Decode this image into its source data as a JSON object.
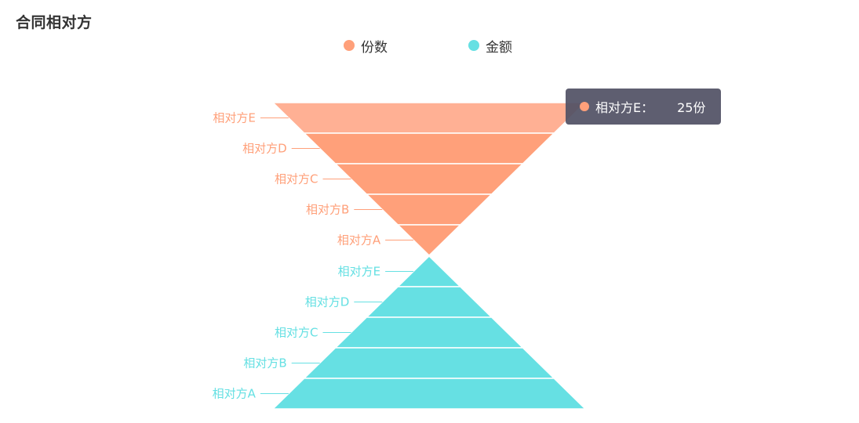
{
  "title": "合同相对方",
  "legend": [
    {
      "name": "份数",
      "color": "#FFA07A"
    },
    {
      "name": "金额",
      "color": "#66E0E3"
    }
  ],
  "tooltip": {
    "name": "相对方E：",
    "value": "25份",
    "color": "#FFA07A"
  },
  "chart_data": [
    {
      "type": "funnel",
      "series_name": "份数",
      "sort": "descending",
      "color": "#FFA07A",
      "highlight_color": "#FFB094",
      "highlighted": "相对方E",
      "labels_position": "left",
      "data": [
        {
          "name": "相对方E",
          "value": 25
        },
        {
          "name": "相对方D",
          "value": 20
        },
        {
          "name": "相对方C",
          "value": 15
        },
        {
          "name": "相对方B",
          "value": 10
        },
        {
          "name": "相对方A",
          "value": 5
        }
      ]
    },
    {
      "type": "funnel",
      "series_name": "金额",
      "sort": "ascending",
      "color": "#66E0E3",
      "labels_position": "left",
      "data": [
        {
          "name": "相对方E",
          "value": 5
        },
        {
          "name": "相对方D",
          "value": 10
        },
        {
          "name": "相对方C",
          "value": 15
        },
        {
          "name": "相对方B",
          "value": 20
        },
        {
          "name": "相对方A",
          "value": 25
        }
      ]
    }
  ]
}
